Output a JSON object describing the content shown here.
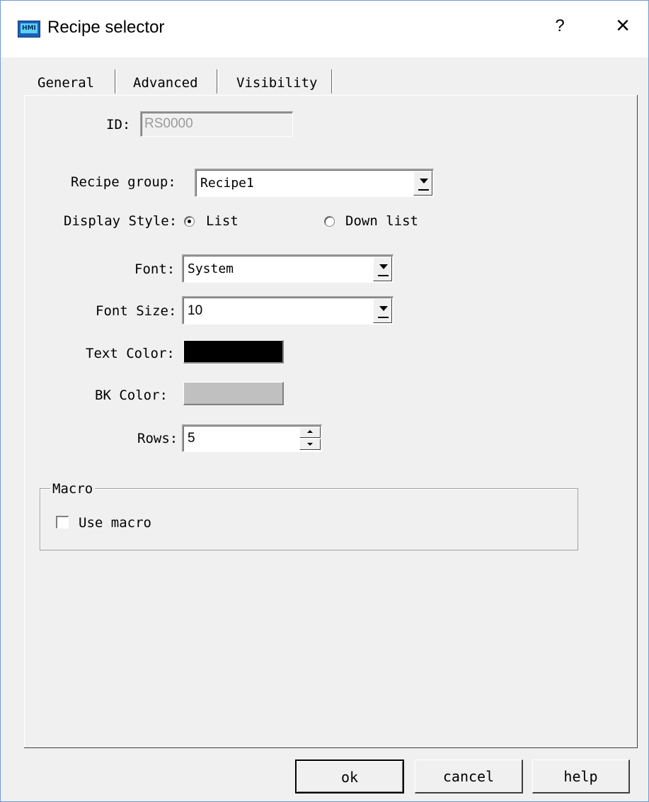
{
  "window": {
    "title": "Recipe selector",
    "app_icon_text": "HMI",
    "help_label": "?",
    "close_label": "×"
  },
  "tabs": [
    {
      "label": "General",
      "active": true
    },
    {
      "label": "Advanced",
      "active": false
    },
    {
      "label": "Visibility",
      "active": false
    }
  ],
  "form": {
    "id_label": "ID:",
    "id_value": "RS0000",
    "recipe_group_label": "Recipe group:",
    "recipe_group_value": "Recipe1",
    "display_style_label": "Display Style:",
    "display_style_options": [
      "List",
      "Down list"
    ],
    "display_style_selected": "List",
    "font_label": "Font:",
    "font_value": "System",
    "font_size_label": "Font Size:",
    "font_size_value": "10",
    "text_color_label": "Text Color:",
    "text_color": "#000000",
    "bk_color_label": "BK Color:",
    "bk_color": "#c0c0c0",
    "rows_label": "Rows:",
    "rows_value": "5"
  },
  "macro": {
    "group_title": "Macro",
    "use_macro_label": "Use macro",
    "use_macro_checked": false
  },
  "buttons": {
    "ok": "ok",
    "cancel": "cancel",
    "help": "help"
  }
}
